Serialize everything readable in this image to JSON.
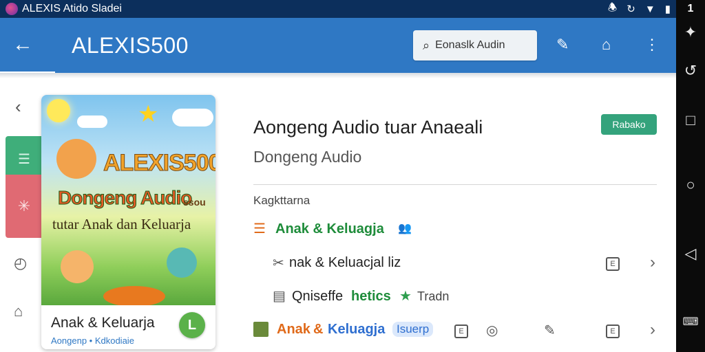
{
  "status_bar": {
    "title": "ALEXIS Atido Sladei",
    "icons": [
      "notification-icon",
      "sync-icon",
      "wifi-icon",
      "battery-icon"
    ],
    "clock": "1"
  },
  "app_bar": {
    "title": "ALEXIS500",
    "search_label": "Eonaslk Audin"
  },
  "cover": {
    "title_line1": "ALEXIS500",
    "title_line2": "Dongeng Audio",
    "title_line2_tag": "ssou",
    "title_line3": "tutar Anak dan Keluarja",
    "name": "Anak & Keluarja",
    "sub": "Aongenp • Kdkodiaie"
  },
  "detail": {
    "title": "Aongeng Audio tuar Anaeali",
    "subtitle": "Dongeng Audio",
    "badge": "Rabako",
    "section_label": "Kagkttarna",
    "rows": [
      {
        "text": "Anak & Keluagja"
      },
      {
        "text": "nak & Keluacjal liz"
      },
      {
        "text_a": "Qniseffe",
        "text_b": "hetics",
        "text_c": "Tradn"
      },
      {
        "text_a": "Anak",
        "text_amp": "&",
        "text_b": "Keluagja",
        "text_c": "Isuerp"
      }
    ]
  },
  "colors": {
    "status_bar": "#0c2f5c",
    "app_bar": "#2f78c4",
    "badge": "#34a37c",
    "green_text": "#1e8c3a",
    "orange_text": "#e06a1a",
    "blue_text": "#2f6fd0"
  }
}
